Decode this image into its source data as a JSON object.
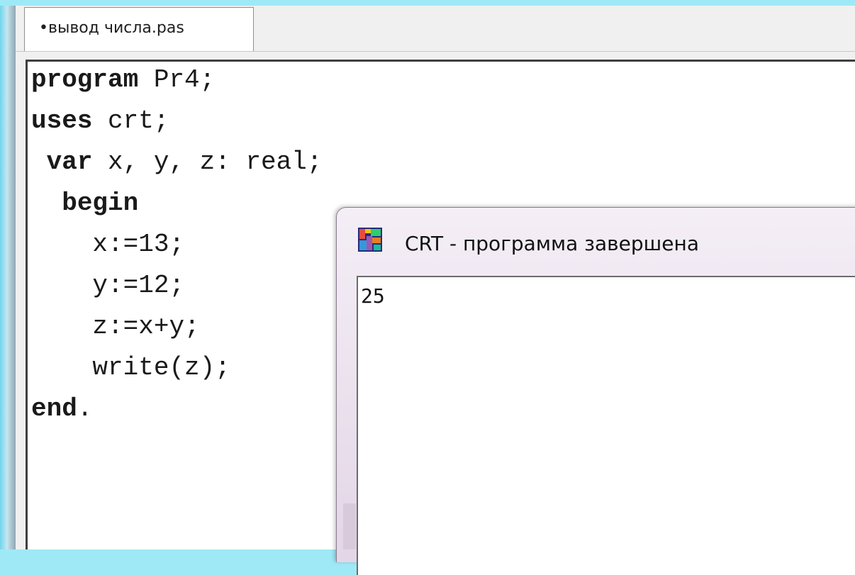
{
  "editor": {
    "tab_label": "•вывод числа.pas",
    "code_lines": [
      {
        "kw": "program",
        "rest": " Pr4;"
      },
      {
        "kw": "uses",
        "rest": " crt;"
      },
      {
        "pre": " ",
        "kw": "var",
        "rest": " x, y, z: real;"
      },
      {
        "pre": "  ",
        "kw": "begin",
        "rest": ""
      },
      {
        "pre": "    ",
        "kw": "",
        "rest": "x:=13;"
      },
      {
        "pre": "    ",
        "kw": "",
        "rest": "y:=12;"
      },
      {
        "pre": "    ",
        "kw": "",
        "rest": "z:=x+y;"
      },
      {
        "pre": "    ",
        "kw": "",
        "rest": "write(z);"
      },
      {
        "kw": "end",
        "rest": "."
      }
    ]
  },
  "crt_window": {
    "title": "CRT - программа завершена",
    "icon": "crt-app-icon",
    "output": "25"
  },
  "colors": {
    "background": "#9fe9f7",
    "editor_bg": "#ffffff",
    "crt_frame": "#e3d6e6"
  }
}
